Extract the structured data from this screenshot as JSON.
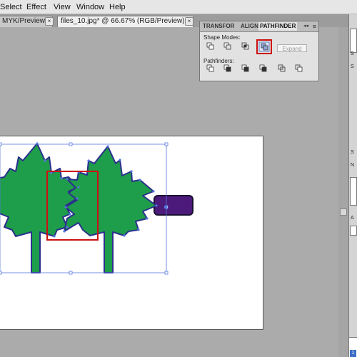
{
  "menu": {
    "items": [
      "Select",
      "Effect",
      "View",
      "Window",
      "Help"
    ]
  },
  "documents": {
    "tabs": [
      {
        "label": "MYK/Preview)",
        "active": false
      },
      {
        "label": "files_10.jpg* @ 66.67% (RGB/Preview)",
        "active": true
      }
    ],
    "close_glyph": "×"
  },
  "pathfinder_panel": {
    "tabs": [
      "TRANSFOR",
      "ALIGN",
      "PATHFINDER"
    ],
    "active_tab": "PATHFINDER",
    "menu_glyph": "≡",
    "collapse_glyph": "◂◂",
    "shape_modes_label": "Shape Modes:",
    "shape_modes": [
      "unite-icon",
      "minus-front-icon",
      "intersect-icon",
      "exclude-icon"
    ],
    "selected_shape_mode": "exclude-icon",
    "expand_label": "Expand",
    "pathfinders_label": "Pathfinders:",
    "pathfinders": [
      "divide-icon",
      "trim-icon",
      "merge-icon",
      "crop-icon",
      "outline-icon",
      "minus-back-icon"
    ]
  },
  "right_dock": {
    "labels": [
      "S",
      "S",
      "S",
      "N",
      "A",
      "1"
    ]
  },
  "colors": {
    "leaf_fill": "#1e9d4a",
    "leaf_stroke": "#2b2f8c",
    "selection": "#5577dd",
    "highlight": "#cc1111",
    "shape_fill": "#4b1a7a"
  }
}
